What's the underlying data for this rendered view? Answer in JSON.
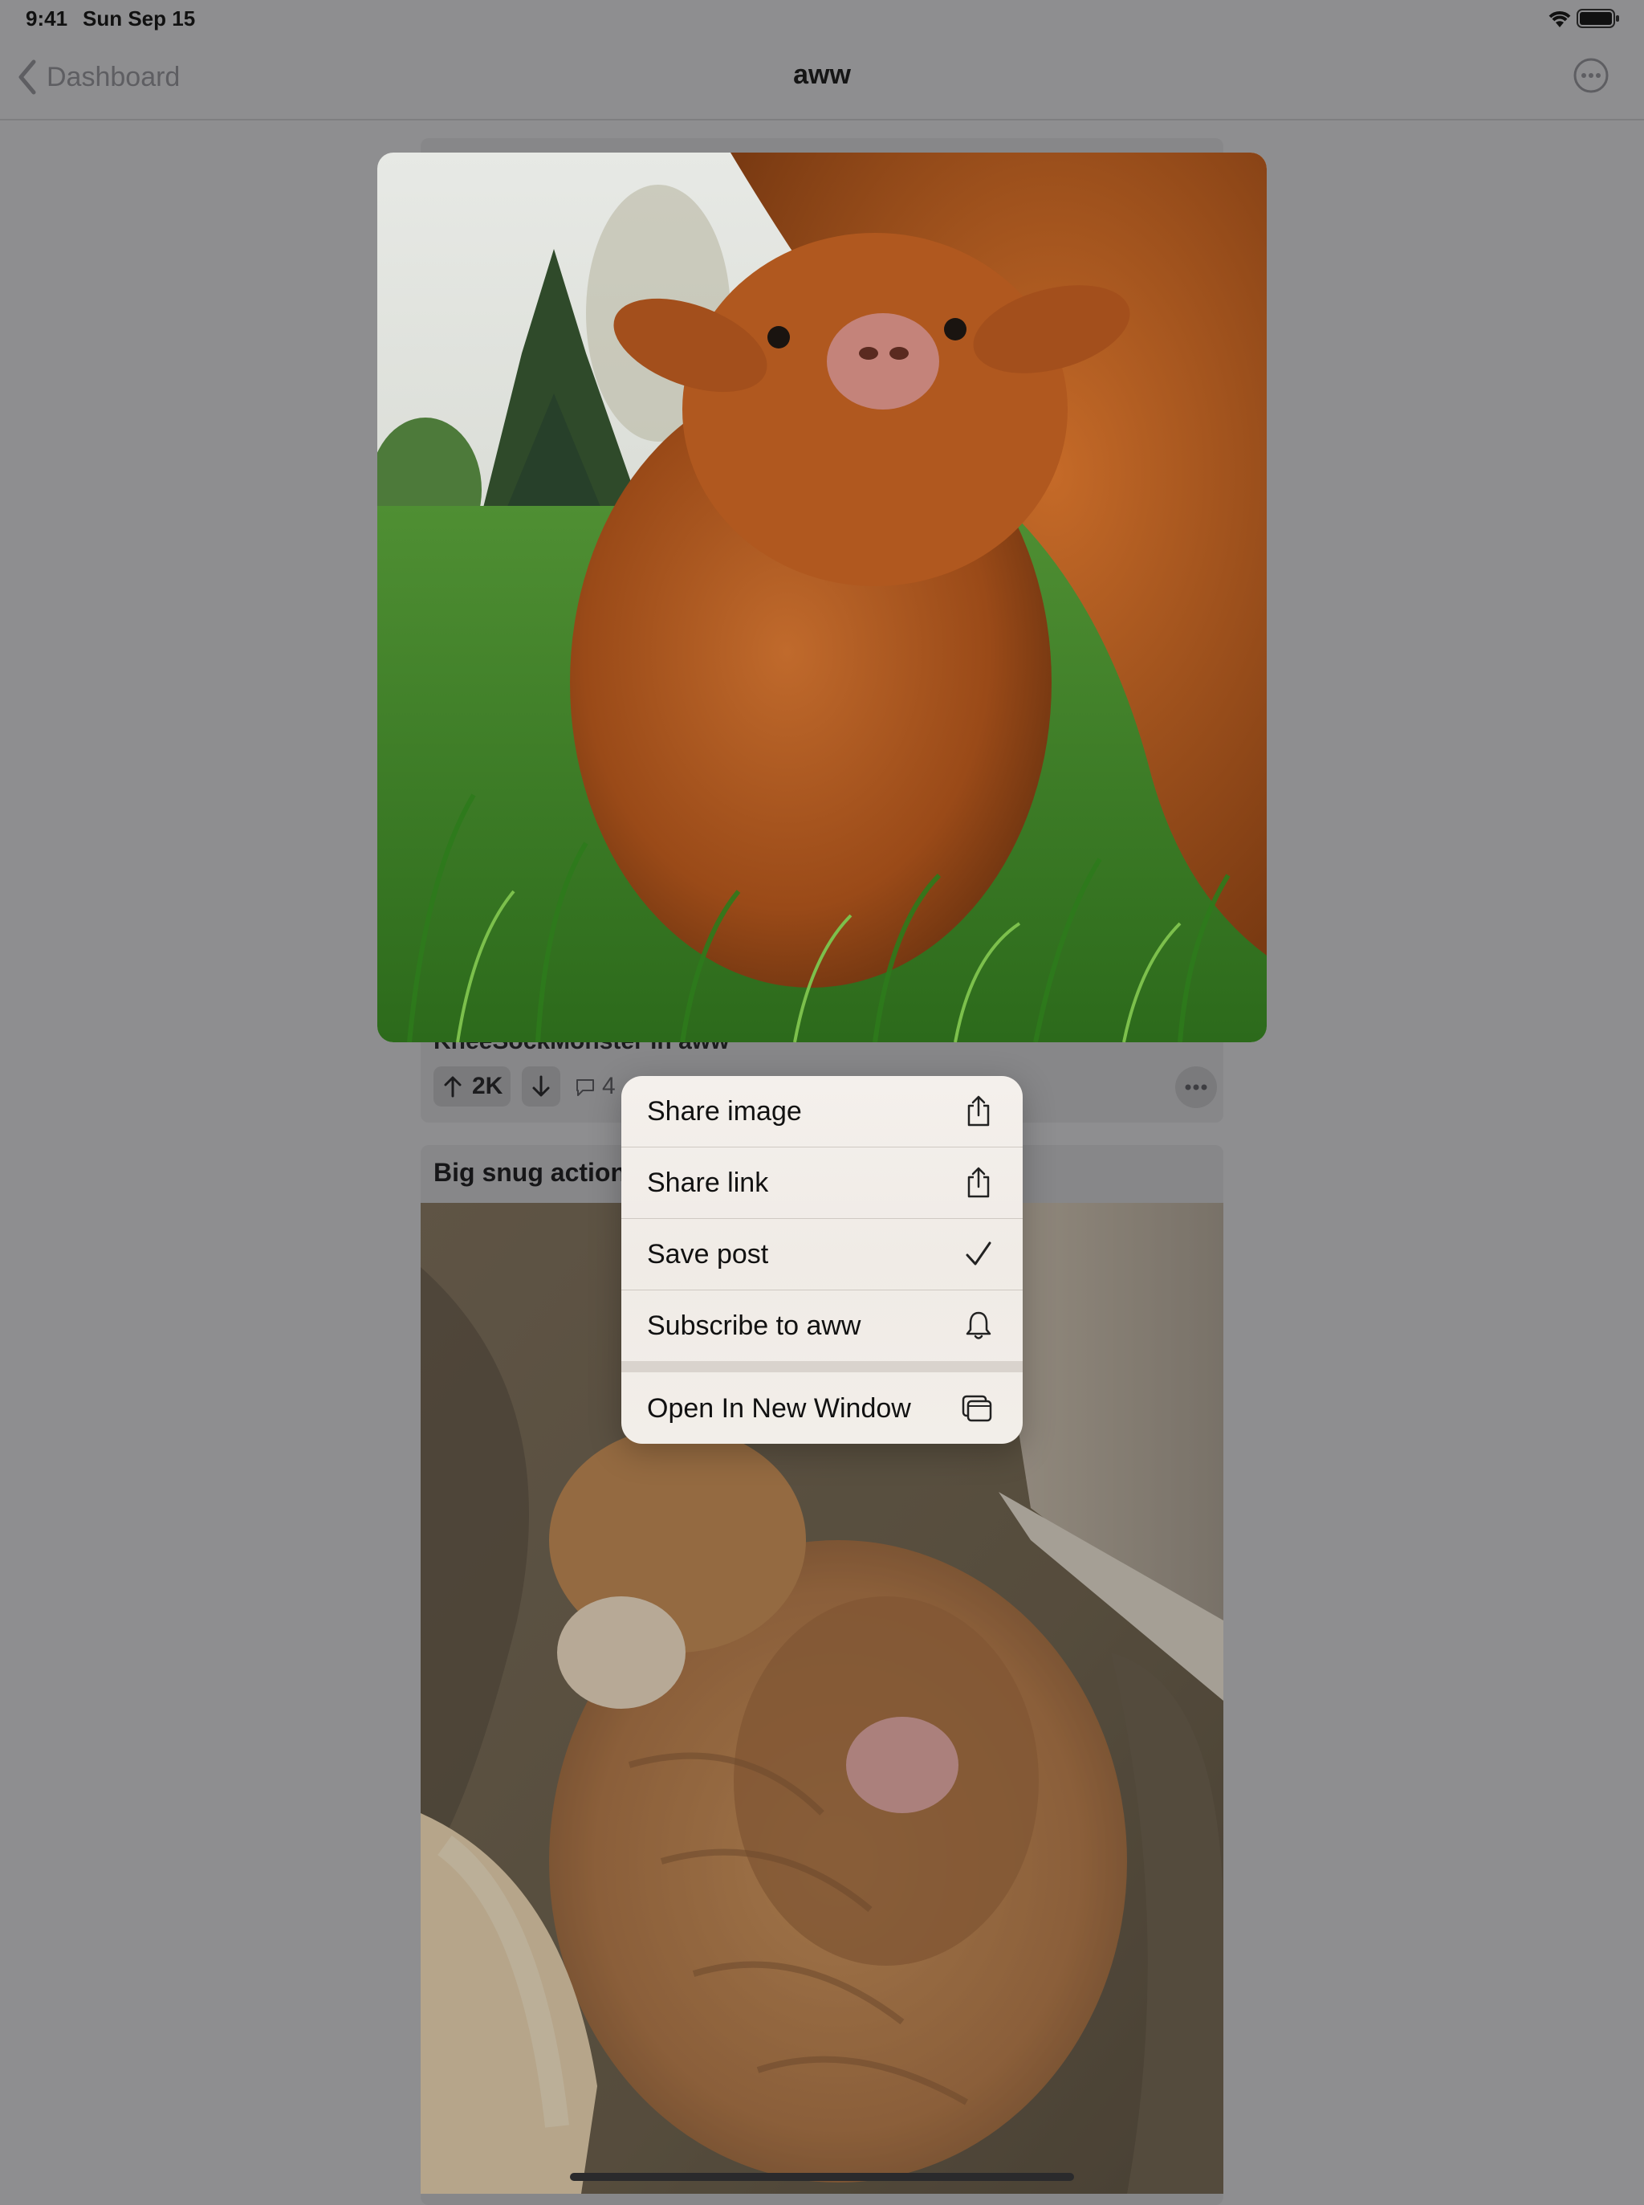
{
  "status_bar": {
    "time": "9:41",
    "date": "Sun Sep 15",
    "wifi_icon": "wifi-icon",
    "battery_icon": "battery-icon"
  },
  "nav": {
    "back_label": "Dashboard",
    "back_icon": "chevron-left-icon",
    "title": "aww",
    "more_icon": "ellipsis-circle-icon"
  },
  "posts": [
    {
      "author_line": "KneeSockMonster in aww",
      "score": "2K",
      "comment_count": "4",
      "image_desc": "highland-calf-photo"
    },
    {
      "title": "Big snug action",
      "image_desc": "sleeping-orange-kittens-photo"
    }
  ],
  "context_menu": {
    "items": [
      {
        "label": "Share image",
        "icon": "share-icon"
      },
      {
        "label": "Share link",
        "icon": "share-icon"
      },
      {
        "label": "Save post",
        "icon": "checkmark-icon"
      },
      {
        "label": "Subscribe to aww",
        "icon": "bell-icon"
      },
      {
        "label": "Open In New Window",
        "icon": "new-window-icon"
      }
    ]
  },
  "colors": {
    "dim_overlay": "#8e8e90",
    "menu_background": "#f2eee9"
  }
}
